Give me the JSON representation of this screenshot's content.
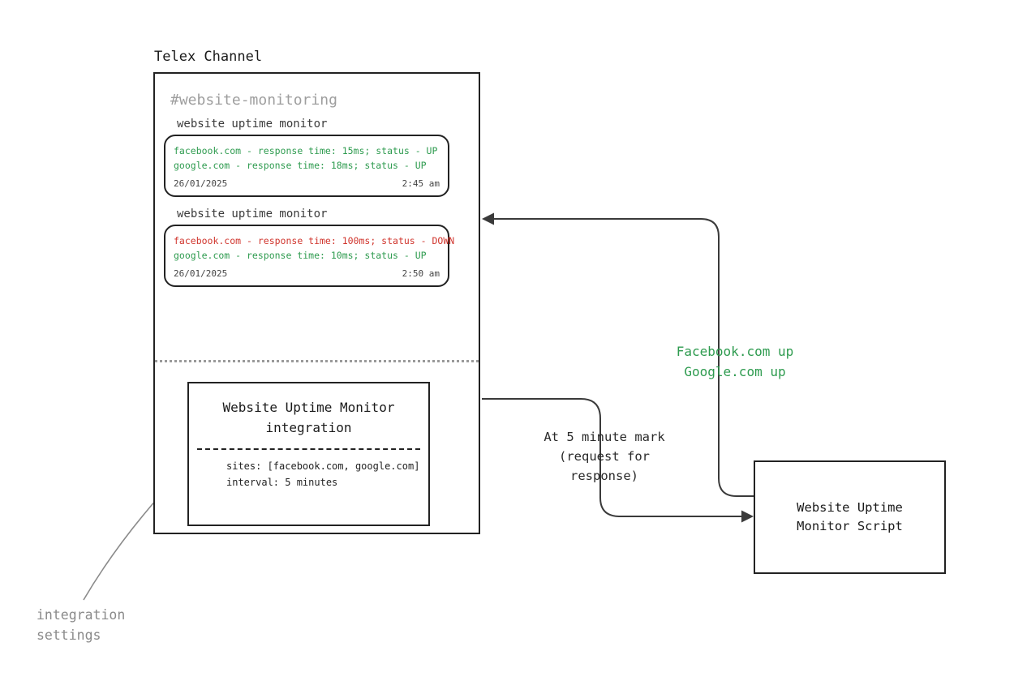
{
  "channel": {
    "outer_label": "Telex Channel",
    "hash_title": "#website-monitoring"
  },
  "messages": [
    {
      "sender": "website uptime monitor",
      "lines": [
        {
          "text": "facebook.com - response time: 15ms; status - UP",
          "status": "up"
        },
        {
          "text": "google.com - response time: 18ms; status - UP",
          "status": "up"
        }
      ],
      "date": "26/01/2025",
      "time": "2:45 am"
    },
    {
      "sender": "website uptime monitor",
      "lines": [
        {
          "text": "facebook.com - response time: 100ms; status - DOWN",
          "status": "down"
        },
        {
          "text": "google.com - response time: 10ms; status - UP",
          "status": "up"
        }
      ],
      "date": "26/01/2025",
      "time": "2:50 am"
    }
  ],
  "integration_box": {
    "title_l1": "Website Uptime Monitor",
    "title_l2": "integration",
    "config_sites": "sites: [facebook.com, google.com]",
    "config_interval": "interval: 5 minutes"
  },
  "flow": {
    "request_l1": "At 5 minute mark",
    "request_l2": "(request for",
    "request_l3": "response)",
    "response_l1": "Facebook.com up",
    "response_l2": "Google.com up"
  },
  "script_box": {
    "line1": "Website Uptime",
    "line2": "Monitor Script"
  },
  "annotation": {
    "settings_l1": "integration",
    "settings_l2": "settings"
  }
}
